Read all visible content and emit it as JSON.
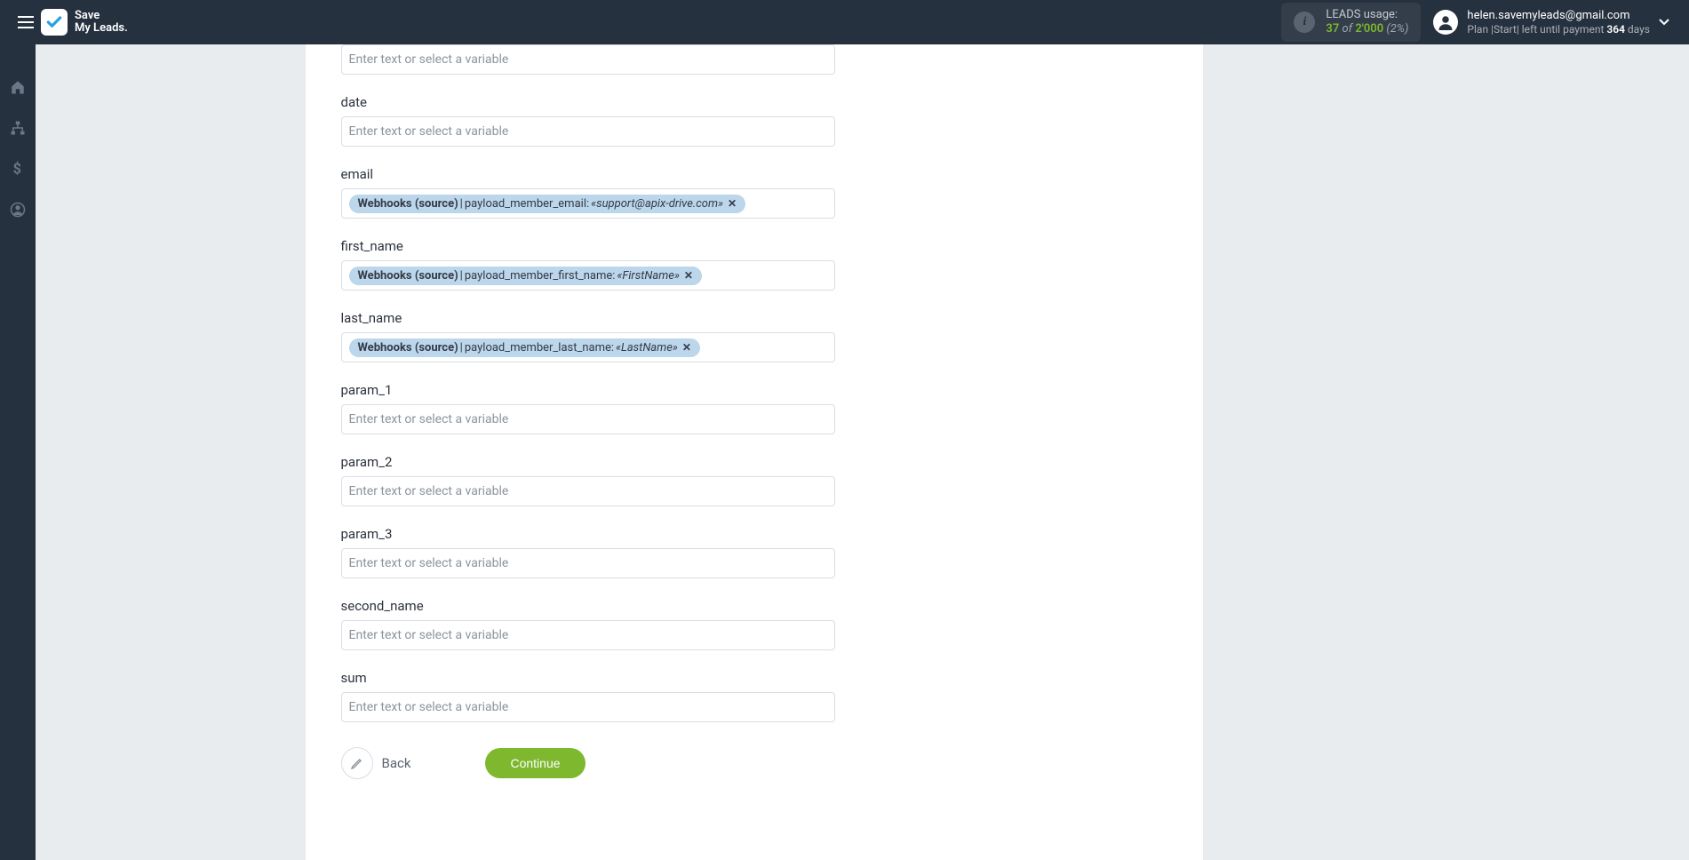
{
  "header": {
    "brand_line1": "Save",
    "brand_line2": "My Leads.",
    "leads_usage_label": "LEADS usage:",
    "leads_used": "37",
    "leads_of": "of",
    "leads_total": "2'000",
    "leads_pct": "(2%)",
    "account_email": "helen.savemyleads@gmail.com",
    "plan_prefix": "Plan |Start| left until payment ",
    "plan_days_num": "364",
    "plan_days_suffix": " days"
  },
  "form": {
    "placeholder": "Enter text or select a variable",
    "fields": [
      {
        "label": "",
        "tag": null,
        "cut": true
      },
      {
        "label": "date",
        "tag": null
      },
      {
        "label": "email",
        "tag": {
          "source": "Webhooks (source)",
          "field": "payload_member_email:",
          "value": "«support@apix-drive.com»"
        }
      },
      {
        "label": "first_name",
        "tag": {
          "source": "Webhooks (source)",
          "field": "payload_member_first_name:",
          "value": "«FirstName»"
        }
      },
      {
        "label": "last_name",
        "tag": {
          "source": "Webhooks (source)",
          "field": "payload_member_last_name:",
          "value": "«LastName»"
        }
      },
      {
        "label": "param_1",
        "tag": null
      },
      {
        "label": "param_2",
        "tag": null
      },
      {
        "label": "param_3",
        "tag": null
      },
      {
        "label": "second_name",
        "tag": null
      },
      {
        "label": "sum",
        "tag": null
      }
    ]
  },
  "actions": {
    "back": "Back",
    "continue": "Continue"
  }
}
